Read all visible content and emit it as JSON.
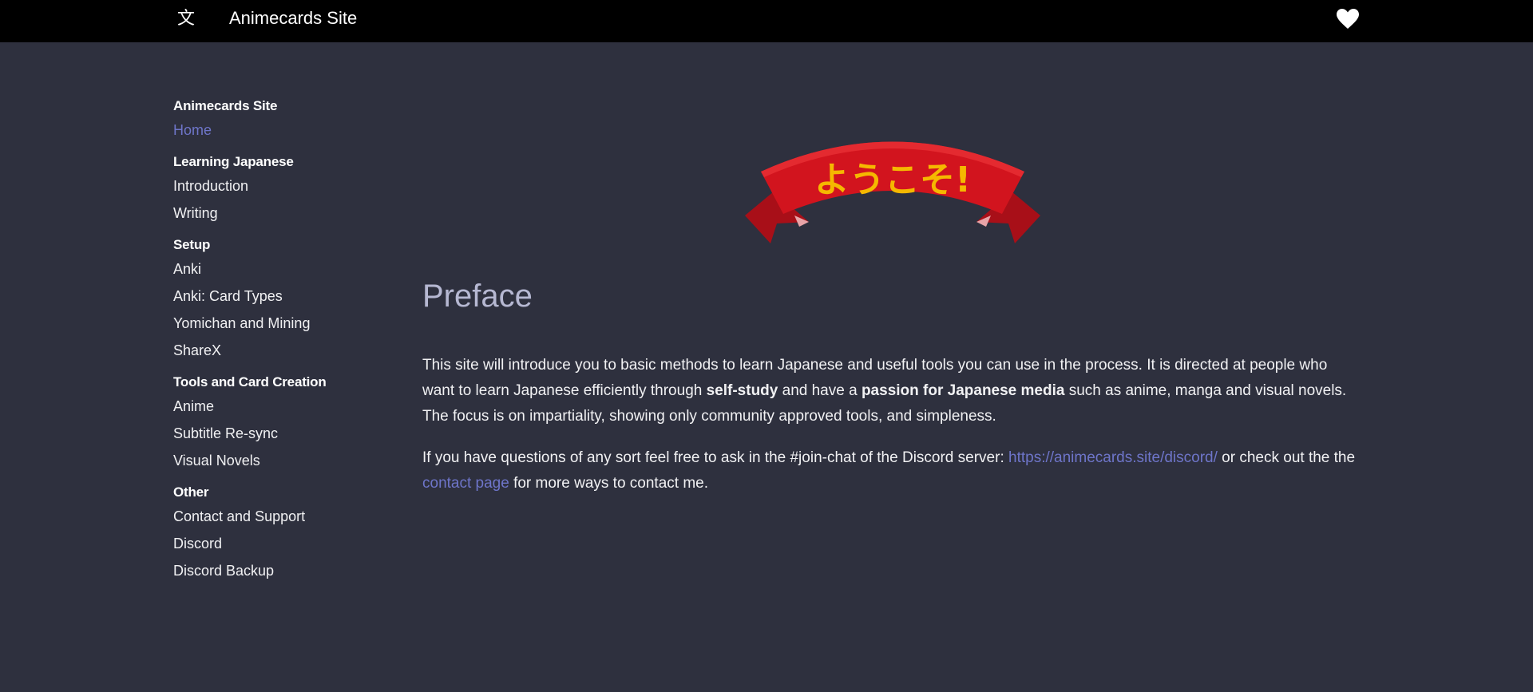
{
  "topbar": {
    "language_icon": "translate-icon",
    "title": "Animecards Site",
    "heart_icon": "heart-icon",
    "background": "#000000"
  },
  "sidebar": {
    "sections": [
      {
        "heading": "Animecards Site",
        "items": [
          "Home"
        ]
      },
      {
        "heading": "Learning Japanese",
        "items": [
          "Introduction",
          "Writing"
        ]
      },
      {
        "heading": "Setup",
        "items": [
          "Anki",
          "Anki: Card Types",
          "Yomichan and Mining",
          "ShareX"
        ]
      },
      {
        "heading": "Tools and Card Creation",
        "items": [
          "Anime",
          "Subtitle Re-sync",
          "Visual Novels"
        ]
      },
      {
        "heading": "Other",
        "items": [
          "Contact and Support",
          "Discord",
          "Discord Backup"
        ]
      }
    ],
    "active_item": "Home"
  },
  "main": {
    "banner_text": "ようこそ!",
    "heading": "Preface",
    "para1": {
      "t1": "This site will introduce you to basic methods to learn Japanese and useful tools you can use in the process. It is directed at people who want to learn Japanese efficiently through ",
      "b1": "self-study",
      "t2": " and have a ",
      "b2": "passion for Japanese media",
      "t3": " such as anime, manga and visual novels. The focus is on impartiality, showing only community approved tools, and simpleness."
    },
    "para2": {
      "t1": "If you have questions of any sort feel free to ask in the #join-chat of the Discord server: ",
      "link1": "https://animecards.site/discord/",
      "t2": " or check out the the ",
      "link2": "contact page",
      "t3": " for more ways to contact me."
    }
  },
  "colors": {
    "page_background": "#2e303e",
    "accent_link": "#6e75c9",
    "heading": "#b6b8d2",
    "banner_red": "#d2141e",
    "banner_text": "#f5b800"
  }
}
